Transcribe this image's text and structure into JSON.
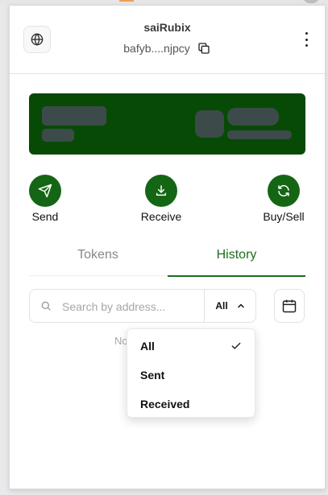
{
  "header": {
    "account_name": "saiRubix",
    "address": "bafyb....njpcy"
  },
  "actions": [
    {
      "label": "Send"
    },
    {
      "label": "Receive"
    },
    {
      "label": "Buy/Sell"
    }
  ],
  "tabs": [
    {
      "label": "Tokens",
      "active": false
    },
    {
      "label": "History",
      "active": true
    }
  ],
  "search": {
    "placeholder": "Search by address...",
    "value": ""
  },
  "filter": {
    "selected": "All",
    "options": [
      {
        "label": "All",
        "checked": true
      },
      {
        "label": "Sent",
        "checked": false
      },
      {
        "label": "Received",
        "checked": false
      }
    ]
  },
  "empty_state": {
    "visible_text": "No"
  },
  "colors": {
    "brand_green": "#146614",
    "card_green": "#064a06",
    "active_tab": "#1b6e1b"
  },
  "icons": {
    "network": "globe-icon",
    "copy": "copy-icon",
    "menu": "more-vertical-icon",
    "send": "send-icon",
    "receive": "download-icon",
    "buy_sell": "refresh-icon",
    "search": "search-icon",
    "filter_open": "chevron-up-icon",
    "calendar": "calendar-icon",
    "selected": "check-icon"
  }
}
